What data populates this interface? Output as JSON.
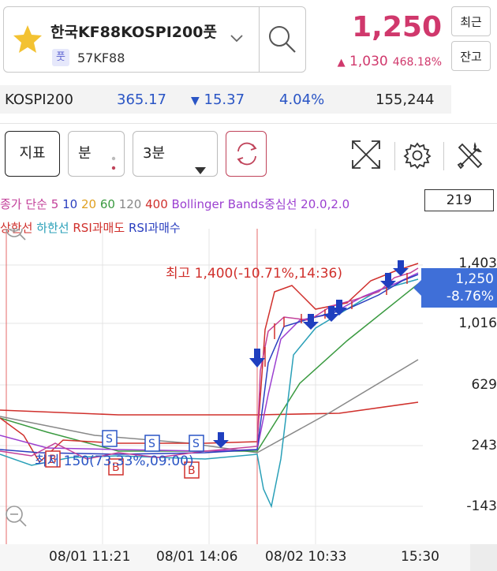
{
  "stock": {
    "name": "한국KF88KOSPI200풋",
    "tag": "풋",
    "code": "57KF88",
    "price": "1,250",
    "change_arrow": "▲",
    "change": "1,030",
    "change_pct": "468.18%"
  },
  "side_buttons": {
    "recent": "최근",
    "balance": "잔고"
  },
  "index": {
    "name": "KOSPI200",
    "value": "365.17",
    "change_arrow": "▼",
    "change": "15.37",
    "change_pct": "4.04%",
    "volume": "155,244"
  },
  "toolbar": {
    "indicator_label": "지표",
    "period_label": "분",
    "interval_value": "3분"
  },
  "legend": {
    "line1": [
      "종가 단순 5",
      "10",
      "20",
      "60",
      "120",
      "400",
      "Bollinger Bands중심선 20.0,2.0"
    ],
    "line2": [
      "상한선",
      "하한선",
      "RSI과매도",
      "RSI과매수"
    ],
    "line1_colors": [
      "#c3419a",
      "#2a3fbf",
      "#e0a020",
      "#3a9a40",
      "#888888",
      "#d0302c",
      "#9b3fd0"
    ],
    "line2_colors": [
      "#d0302c",
      "#2aa0b8",
      "#d0302c",
      "#2a3fbf"
    ]
  },
  "volume_box": "219",
  "y_axis": [
    "1,403",
    "1,016",
    "629",
    "243",
    "-143"
  ],
  "current_badge": {
    "price": "1,250",
    "pct": "-8.76%"
  },
  "annotations": {
    "high": "최고 1,400(-10.71%,14:36)",
    "low": "최저 150(73.33%,09:00)"
  },
  "x_axis": [
    "08/01 11:21",
    "08/01 14:06",
    "08/02 10:33",
    "15:30"
  ],
  "signals": {
    "buy": "B",
    "sell": "S"
  },
  "chart_data": {
    "type": "line",
    "x": [
      "08/01 11:21",
      "08/01 14:06",
      "08/02 10:33",
      "15:30"
    ],
    "ylim": [
      -143,
      1403
    ],
    "series": [
      {
        "name": "종가",
        "values": [
          200,
          250,
          230,
          1100,
          1250
        ]
      }
    ]
  }
}
